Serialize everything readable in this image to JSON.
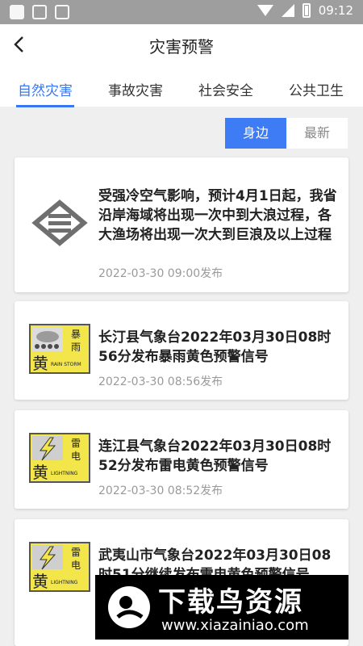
{
  "status_bar": {
    "time": "09:12"
  },
  "header": {
    "title": "灾害预警"
  },
  "tabs": [
    {
      "label": "自然灾害",
      "active": true
    },
    {
      "label": "事故灾害",
      "active": false
    },
    {
      "label": "社会安全",
      "active": false
    },
    {
      "label": "公共卫生",
      "active": false
    }
  ],
  "segment": {
    "nearby": "身边",
    "latest": "最新",
    "selected": "身边"
  },
  "alerts": [
    {
      "icon": "province-emergency-logo",
      "title": "受强冷空气影响，预计4月1日起，我省沿岸海域将出现一次中到大浪过程，各大渔场将出现一次大到巨浪及以上过程",
      "time": "2022-03-30 09:00发布"
    },
    {
      "icon": "rainstorm-yellow-warning-icon",
      "badge_type": "暴雨",
      "badge_level": "黄",
      "badge_en": "RAIN STORM",
      "title": "长汀县气象台2022年03月30日08时56分发布暴雨黄色预警信号",
      "time": "2022-03-30 08:56发布"
    },
    {
      "icon": "lightning-yellow-warning-icon",
      "badge_type": "雷电",
      "badge_level": "黄",
      "badge_en": "LIGHTNING",
      "title": "连江县气象台2022年03月30日08时52分发布雷电黄色预警信号",
      "time": "2022-03-30 08:52发布"
    },
    {
      "icon": "lightning-yellow-warning-icon",
      "badge_type": "雷电",
      "badge_level": "黄",
      "badge_en": "LIGHTNING",
      "title": "武夷山市气象台2022年03月30日08时51分继续发布雷电黄色预警信号"
    }
  ],
  "watermark": {
    "title": "下载鸟资源",
    "url": "www.xiazainiao.com"
  },
  "colors": {
    "accent": "#3777f4",
    "warning_yellow": "#f2e64b",
    "statusbar": "#9e9e9e"
  }
}
